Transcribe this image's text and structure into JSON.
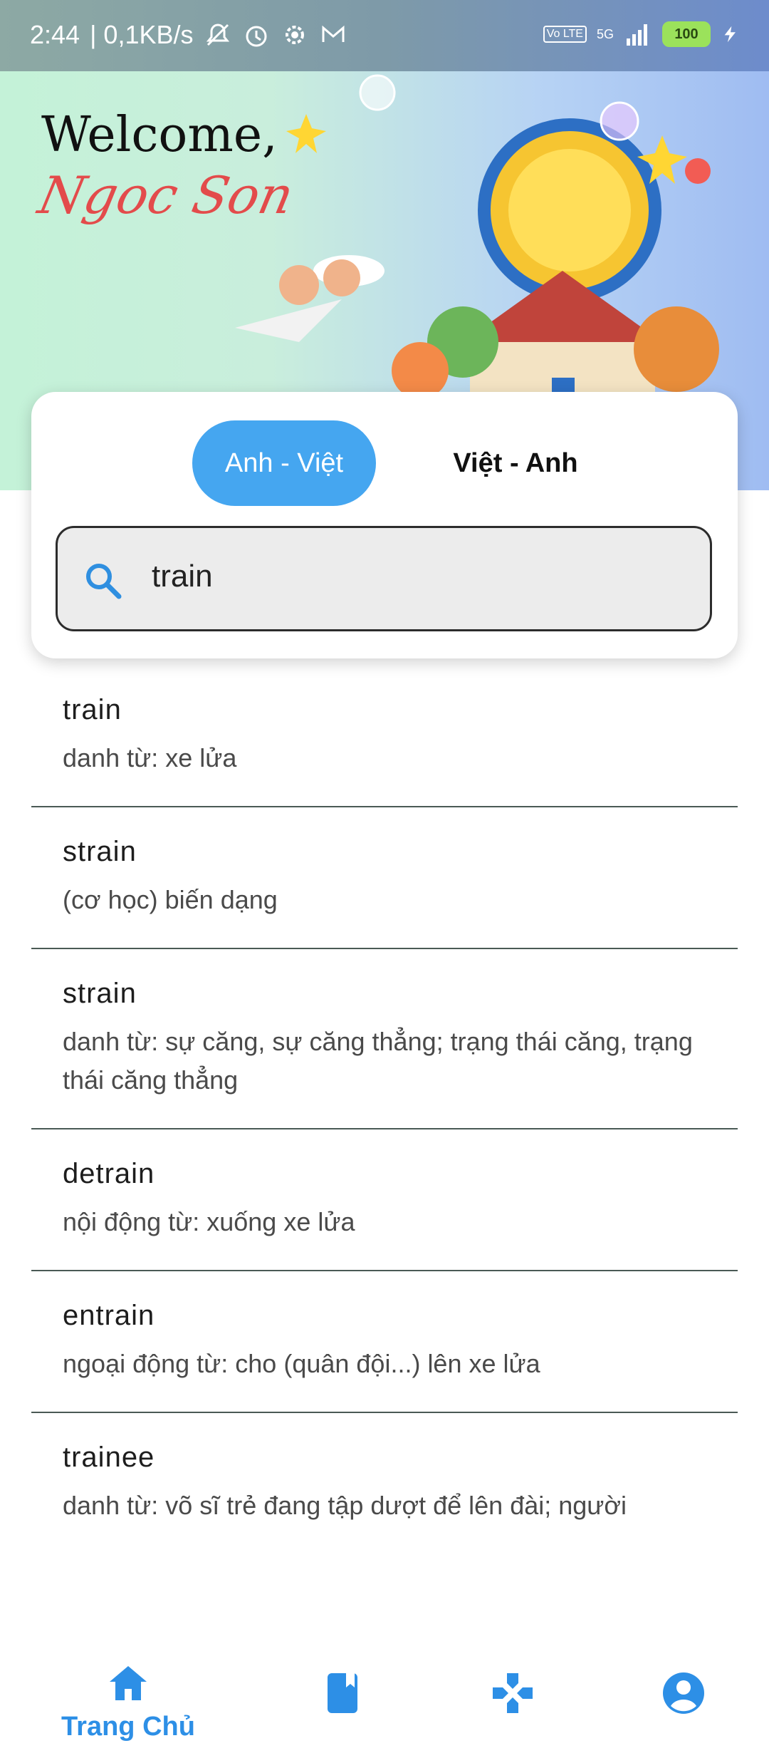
{
  "status_bar": {
    "time": "2:44",
    "network_speed": "| 0,1KB/s",
    "network_type": "5G",
    "volte": "Vo LTE",
    "battery": "100"
  },
  "header": {
    "greeting": "Welcome,",
    "username": "Ngoc Son"
  },
  "language_tabs": [
    {
      "label": "Anh - Việt",
      "selected": true
    },
    {
      "label": "Việt - Anh",
      "selected": false
    }
  ],
  "search": {
    "value": "train",
    "icon": "search-icon"
  },
  "results": [
    {
      "word": "train",
      "meaning": "danh từ: xe lửa"
    },
    {
      "word": "strain",
      "meaning": "(cơ học) biến dạng"
    },
    {
      "word": "strain",
      "meaning": "danh từ: sự căng, sự căng thẳng; trạng thái căng, trạng thái căng thẳng"
    },
    {
      "word": "detrain",
      "meaning": "nội động từ: xuống xe lửa"
    },
    {
      "word": "entrain",
      "meaning": "ngoại động từ: cho (quân đội...) lên xe lửa"
    },
    {
      "word": "trainee",
      "meaning": "danh từ: võ sĩ trẻ đang tập dượt để lên đài; người"
    }
  ],
  "bottom_nav": [
    {
      "icon": "home-icon",
      "label": "Trang Chủ",
      "active": true
    },
    {
      "icon": "book-icon",
      "label": "",
      "active": false
    },
    {
      "icon": "gamepad-icon",
      "label": "",
      "active": false
    },
    {
      "icon": "account-icon",
      "label": "",
      "active": false
    }
  ],
  "colors": {
    "accent": "#45a6f0",
    "nav_active": "#2d8fe6",
    "username": "#e34b4b"
  }
}
